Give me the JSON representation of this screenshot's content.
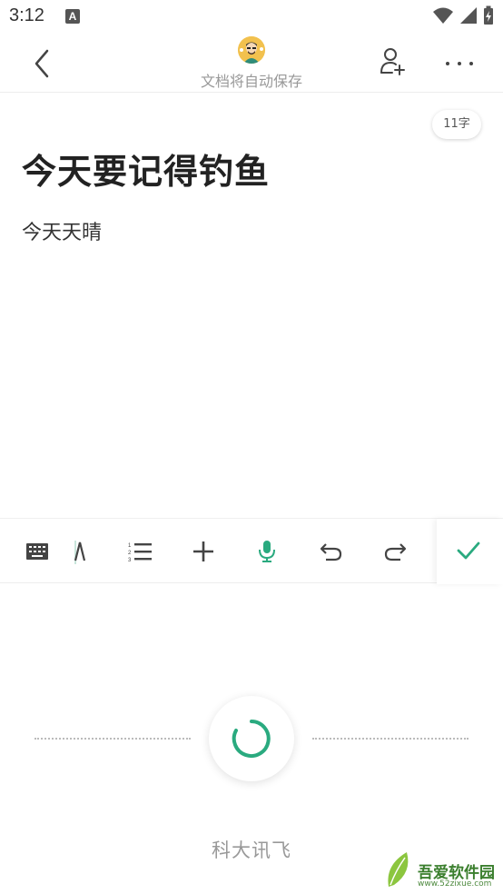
{
  "status_bar": {
    "time": "3:12",
    "notification_icon": "A"
  },
  "header": {
    "subtitle": "文档将自动保存"
  },
  "editor": {
    "word_count": "11字",
    "title": "今天要记得钓鱼",
    "body": "今天天晴"
  },
  "toolbar": {
    "accent_color": "#2aaa7f",
    "tools": [
      "keyboard-icon",
      "text-format-icon",
      "numbered-list-icon",
      "add-icon",
      "microphone-icon",
      "undo-icon",
      "redo-icon",
      "check-icon"
    ]
  },
  "voice": {
    "brand": "科大讯飞"
  },
  "watermark": {
    "text": "吾爱软件园",
    "url": "www.52zixue.com"
  }
}
